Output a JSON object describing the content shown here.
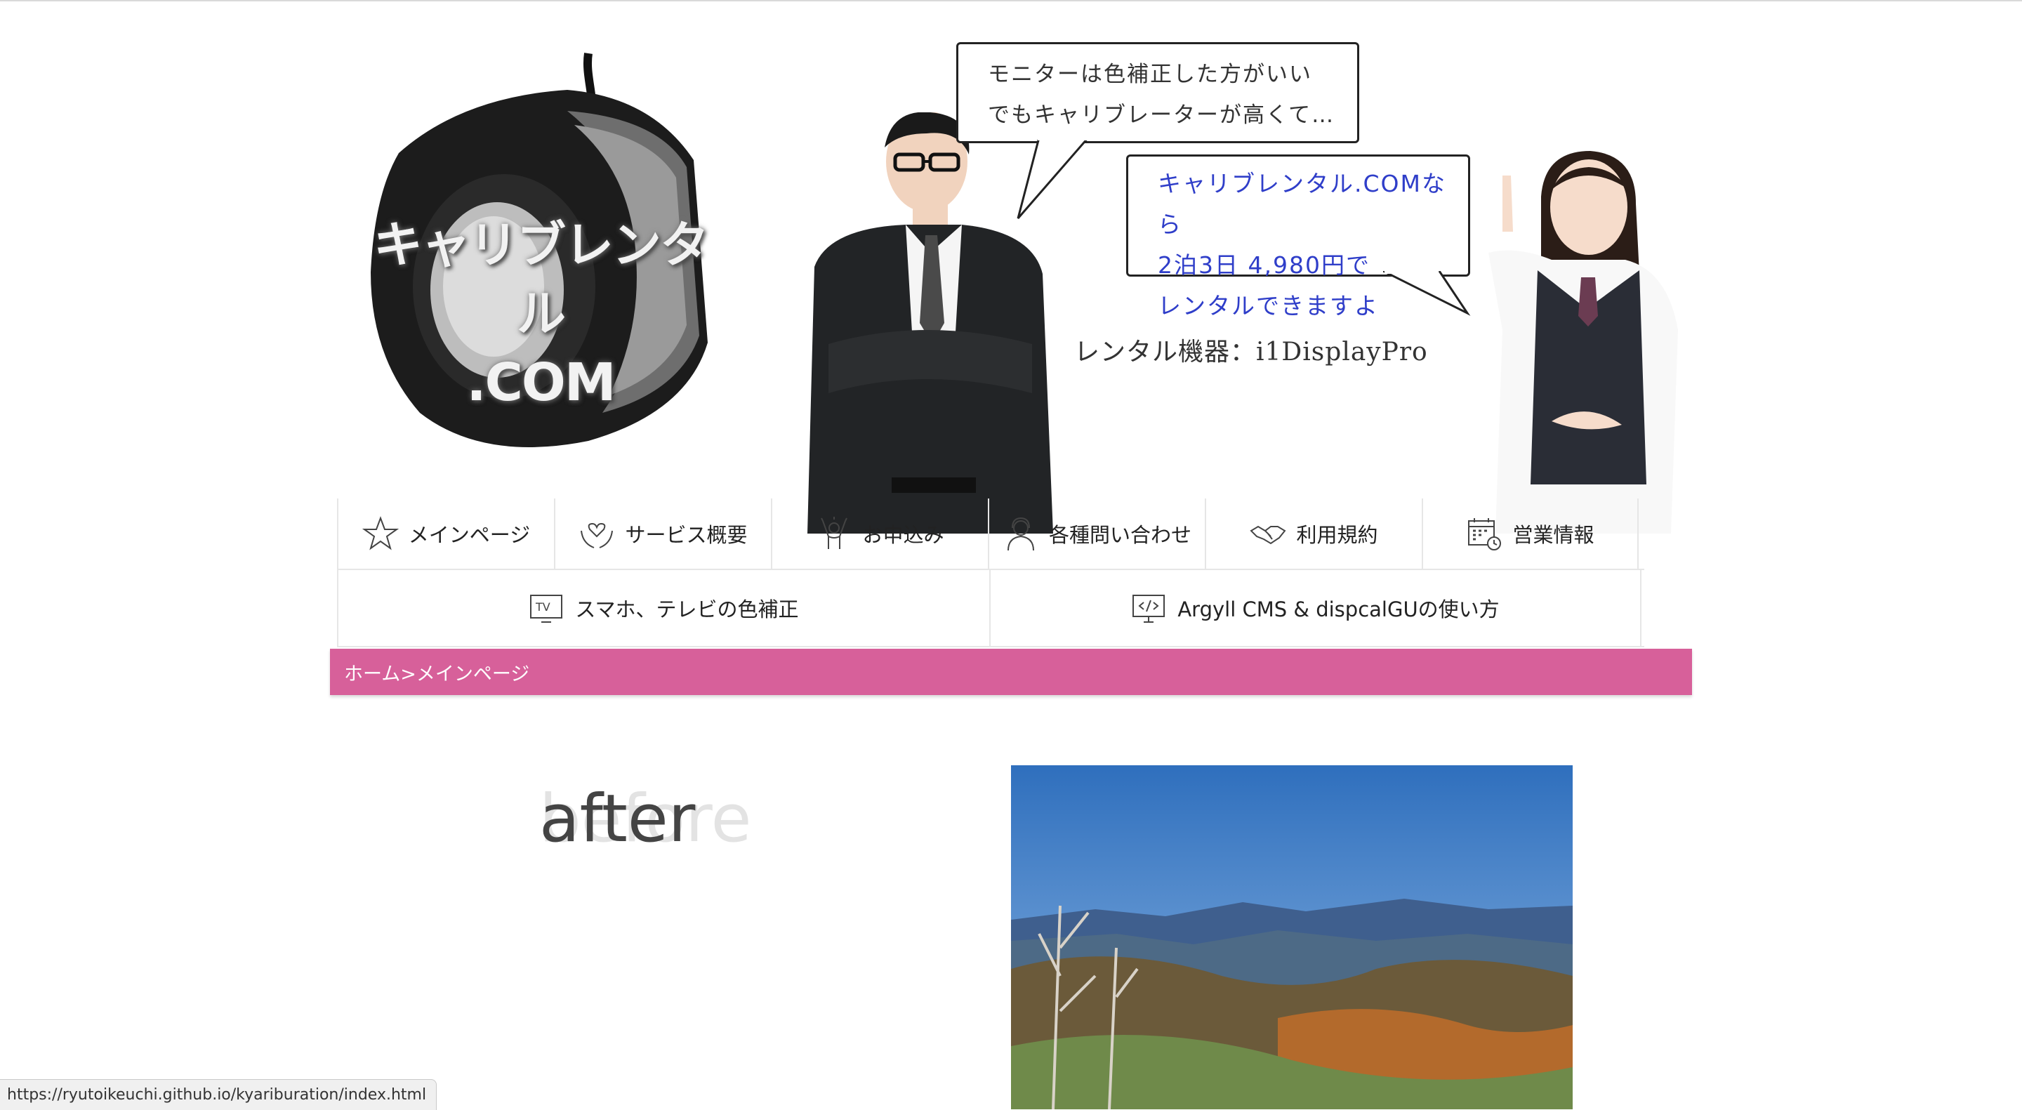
{
  "header": {
    "logo_line1": "キャリブレンタル",
    "logo_line2": ".COM",
    "bubble1_line1": "モニターは色補正した方がいい",
    "bubble1_line2": "でもキャリブレーターが高くて…",
    "bubble2_line1": "キャリブレンタル.COMなら",
    "bubble2_line2": "2泊3日 4,980円で",
    "bubble2_line3": "レンタルできますよ",
    "device_label": "レンタル機器：i1DisplayPro"
  },
  "nav": {
    "row1": [
      {
        "label": "メインページ",
        "icon": "star-icon"
      },
      {
        "label": "サービス概要",
        "icon": "hands-heart-icon"
      },
      {
        "label": "お申込み",
        "icon": "person-celebrate-icon"
      },
      {
        "label": "各種問い合わせ",
        "icon": "support-agent-icon"
      },
      {
        "label": "利用規約",
        "icon": "handshake-icon"
      },
      {
        "label": "営業情報",
        "icon": "calendar-clock-icon"
      }
    ],
    "row2": [
      {
        "label": "スマホ、テレビの色補正",
        "icon": "tv-icon"
      },
      {
        "label": "Argyll CMS & dispcalGUの使い方",
        "icon": "code-monitor-icon"
      }
    ]
  },
  "breadcrumb": "ホーム>メインページ",
  "content": {
    "ghost_word": "before",
    "main_word": "after"
  },
  "status_url": "https://ryutoikeuchi.github.io/kyariburation/index.html",
  "colors": {
    "breadcrumb_bg": "#d7609a",
    "bubble2_text": "#2f3ec9"
  }
}
